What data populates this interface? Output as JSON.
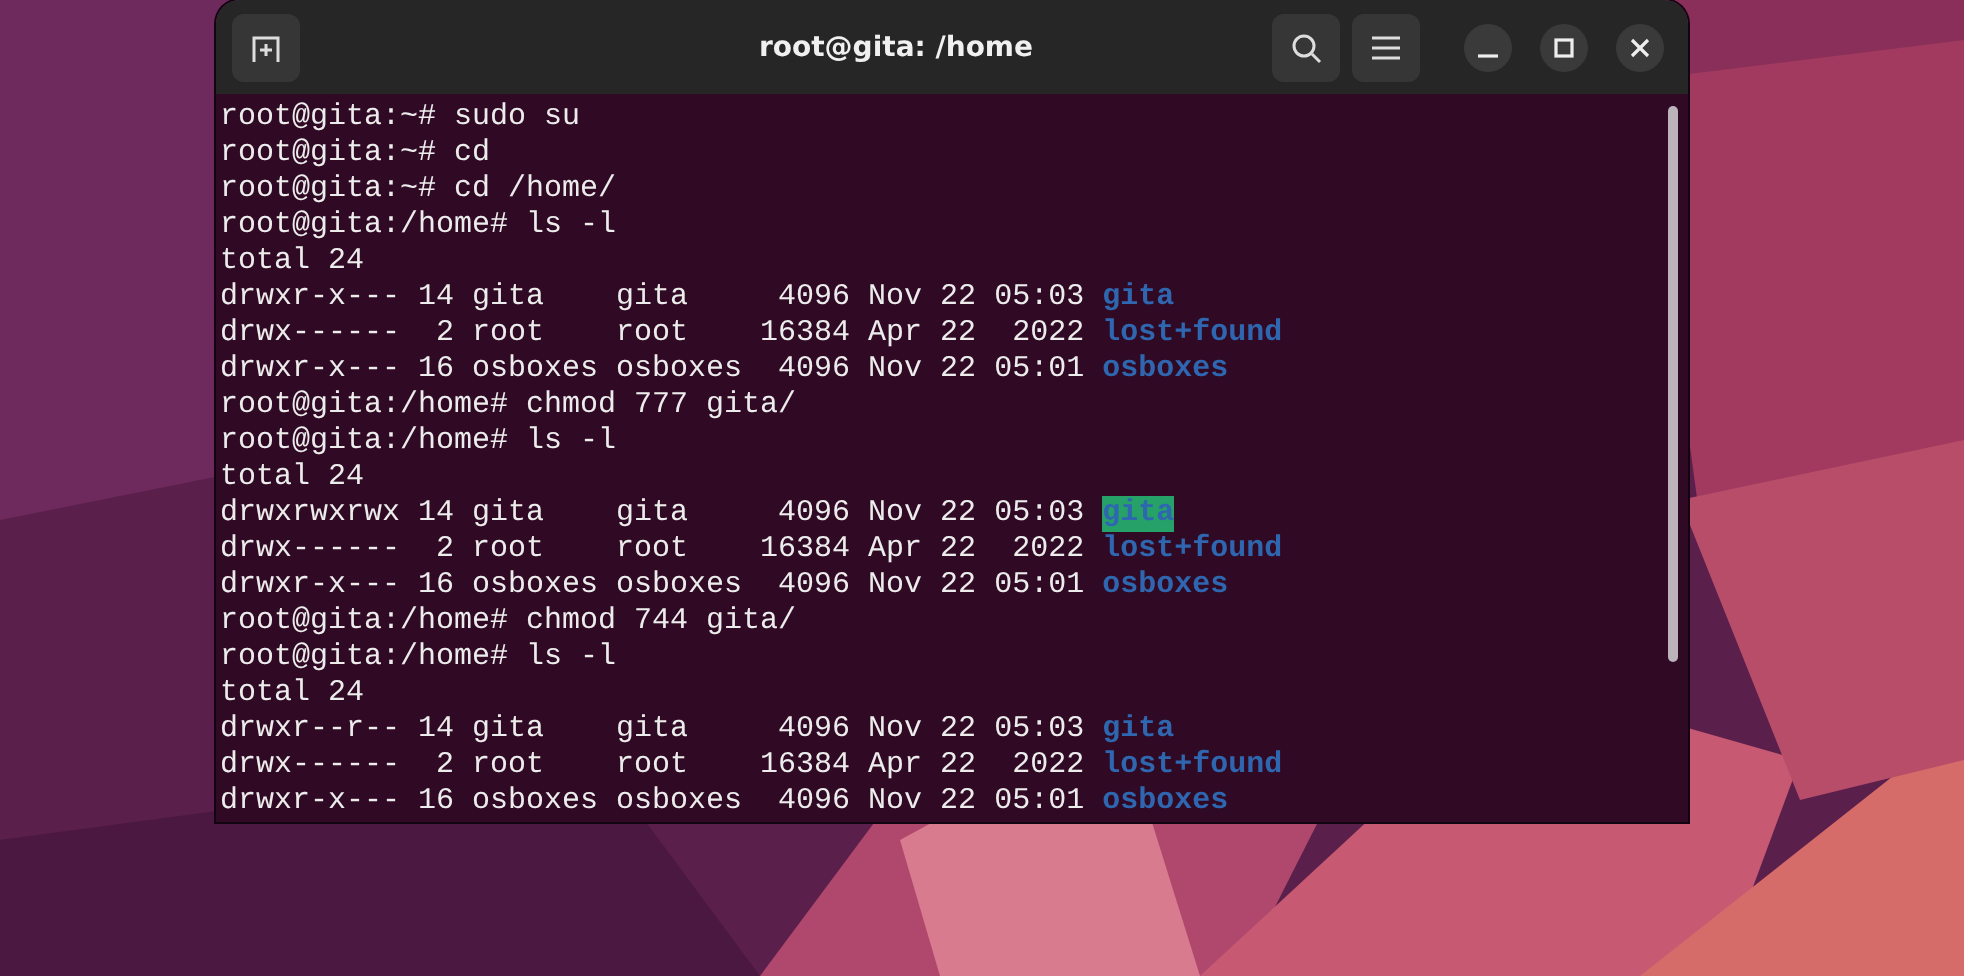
{
  "window": {
    "title": "root@gita: /home"
  },
  "terminal": {
    "lines": [
      {
        "kind": "text",
        "text": "root@gita:~# sudo su"
      },
      {
        "kind": "text",
        "text": "root@gita:~# cd"
      },
      {
        "kind": "text",
        "text": "root@gita:~# cd /home/"
      },
      {
        "kind": "text",
        "text": "root@gita:/home# ls -l"
      },
      {
        "kind": "text",
        "text": "total 24"
      },
      {
        "kind": "entry",
        "text": "drwxr-x--- 14 gita    gita     4096 Nov 22 05:03",
        "name": "gita",
        "highlighted": false
      },
      {
        "kind": "entry",
        "text": "drwx------  2 root    root    16384 Apr 22  2022",
        "name": "lost+found",
        "highlighted": false
      },
      {
        "kind": "entry",
        "text": "drwxr-x--- 16 osboxes osboxes  4096 Nov 22 05:01",
        "name": "osboxes",
        "highlighted": false
      },
      {
        "kind": "text",
        "text": "root@gita:/home# chmod 777 gita/"
      },
      {
        "kind": "text",
        "text": "root@gita:/home# ls -l"
      },
      {
        "kind": "text",
        "text": "total 24"
      },
      {
        "kind": "entry",
        "text": "drwxrwxrwx 14 gita    gita     4096 Nov 22 05:03",
        "name": "gita",
        "highlighted": true
      },
      {
        "kind": "entry",
        "text": "drwx------  2 root    root    16384 Apr 22  2022",
        "name": "lost+found",
        "highlighted": false
      },
      {
        "kind": "entry",
        "text": "drwxr-x--- 16 osboxes osboxes  4096 Nov 22 05:01",
        "name": "osboxes",
        "highlighted": false
      },
      {
        "kind": "text",
        "text": "root@gita:/home# chmod 744 gita/"
      },
      {
        "kind": "text",
        "text": "root@gita:/home# ls -l"
      },
      {
        "kind": "text",
        "text": "total 24"
      },
      {
        "kind": "entry",
        "text": "drwxr--r-- 14 gita    gita     4096 Nov 22 05:03",
        "name": "gita",
        "highlighted": false
      },
      {
        "kind": "entry",
        "text": "drwx------  2 root    root    16384 Apr 22  2022",
        "name": "lost+found",
        "highlighted": false
      },
      {
        "kind": "entry",
        "text": "drwxr-x--- 16 osboxes osboxes  4096 Nov 22 05:01",
        "name": "osboxes",
        "highlighted": false
      }
    ]
  }
}
